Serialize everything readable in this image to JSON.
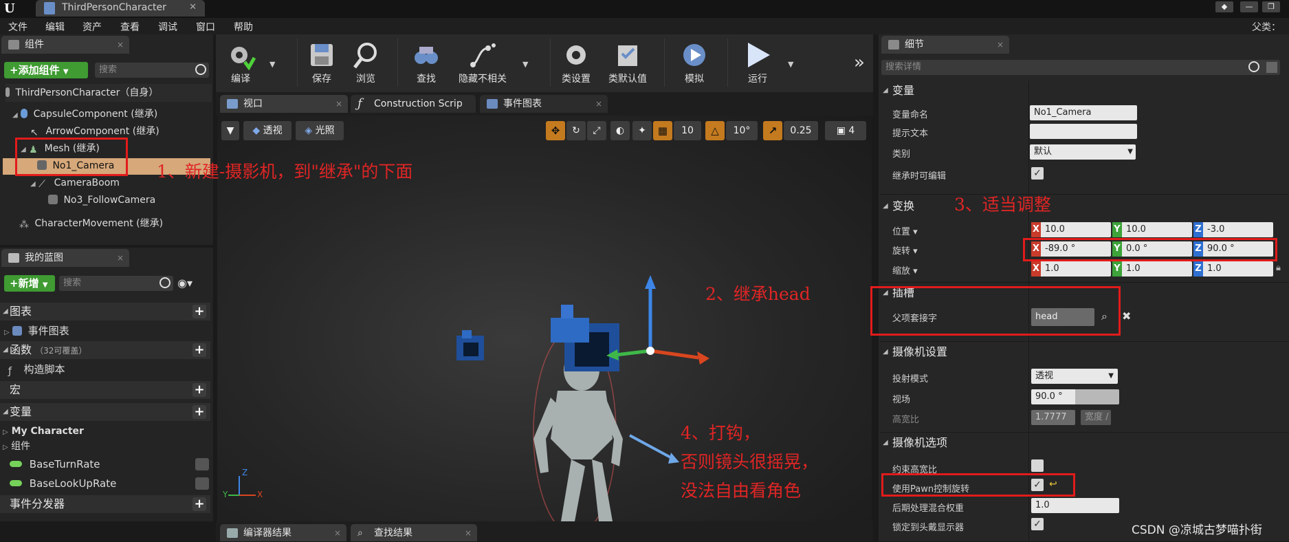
{
  "window": {
    "tab_title": "ThirdPersonCharacter",
    "logo": "U"
  },
  "menu": {
    "items": [
      "文件",
      "编辑",
      "资产",
      "查看",
      "调试",
      "窗口",
      "帮助"
    ],
    "parent_class": "父类："
  },
  "components": {
    "tab": "组件",
    "add_button": "+添加组件",
    "search_placeholder": "搜索",
    "root": "ThirdPersonCharacter（自身）",
    "tree": [
      "CapsuleComponent (继承)",
      "ArrowComponent (继承)",
      "Mesh (继承)",
      "No1_Camera",
      "CameraBoom",
      "No3_FollowCamera",
      "CharacterMovement (继承)"
    ]
  },
  "blueprint": {
    "tab": "我的蓝图",
    "new_button": "+新增",
    "search_placeholder": "搜索",
    "sections": {
      "graphs": "图表",
      "event_graph": "事件图表",
      "functions": "函数",
      "functions_note": "（32可覆盖）",
      "construction_script": "构造脚本",
      "macros": "宏",
      "variables": "变量",
      "my_character": "My Character",
      "components": "组件",
      "var1": "BaseTurnRate",
      "var2": "BaseLookUpRate",
      "dispatchers": "事件分发器"
    }
  },
  "toolbar": {
    "buttons": [
      "编译",
      "保存",
      "浏览",
      "查找",
      "隐藏不相关",
      "类设置",
      "类默认值",
      "模拟",
      "运行"
    ],
    "more": "»"
  },
  "editor_tabs": [
    "视口",
    "Construction Scrip",
    "事件图表"
  ],
  "viewport": {
    "perspective": "透视",
    "lit": "光照",
    "grid_snap": "10",
    "rot_snap": "10°",
    "scale_snap": "0.25",
    "cam_speed": "4",
    "axis_y": "Y",
    "axis_x": "X",
    "axis_z": "Z"
  },
  "details": {
    "tab": "细节",
    "search_placeholder": "搜索详情",
    "variable_section": "变量",
    "var_name_label": "变量命名",
    "var_name_value": "No1_Camera",
    "tooltip_label": "提示文本",
    "category_label": "类别",
    "category_value": "默认",
    "editable_label": "继承时可编辑",
    "transform_section": "变换",
    "location_label": "位置",
    "location": [
      "10.0",
      "10.0",
      "-3.0"
    ],
    "rotation_label": "旋转",
    "rotation": [
      "-89.0 °",
      "0.0 °",
      "90.0 °"
    ],
    "scale_label": "缩放",
    "scale": [
      "1.0",
      "1.0",
      "1.0"
    ],
    "socket_section": "插槽",
    "parent_socket_label": "父项套接字",
    "parent_socket_value": "head",
    "camera_settings_section": "摄像机设置",
    "projection_label": "投射模式",
    "projection_value": "透视",
    "fov_label": "视场",
    "fov_value": "90.0 °",
    "aspect_label": "高宽比",
    "aspect_value": "1.7777",
    "width_value": "宽度 /",
    "camera_options_section": "摄像机选项",
    "constrain_label": "约束高宽比",
    "pawn_rotation_label": "使用Pawn控制旋转",
    "post_process_label": "后期处理混合权重",
    "post_process_value": "1.0",
    "lock_hmd_label": "锁定到头戴显示器"
  },
  "bottom_tabs": [
    "编译器结果",
    "查找结果"
  ],
  "annotations": {
    "a1": "1、新建-摄影机，到\"继承\"的下面",
    "a2": "2、继承head",
    "a3": "3、适当调整",
    "a4_l1": "4、打钩，",
    "a4_l2": "否则镜头很摇晃，",
    "a4_l3": "没法自由看角色"
  },
  "watermark": "CSDN @凉城古梦喵扑街"
}
